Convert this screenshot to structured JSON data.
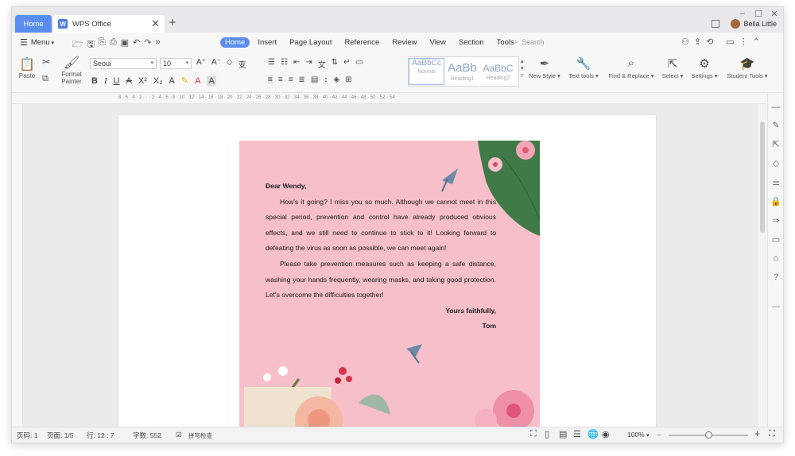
{
  "title_bar": {
    "home_tab": "Home",
    "doc_tab": "WPS Office",
    "doc_icon_letter": "W",
    "close_symbol": "✕",
    "add_symbol": "+",
    "user_name": "Bella Little",
    "window_controls": [
      "–",
      "☐",
      "✕"
    ]
  },
  "menu_bar": {
    "menu_label": "Menu",
    "tabs": [
      "Home",
      "Insert",
      "Page Layout",
      "Reference",
      "Review",
      "View",
      "Section",
      "Tools"
    ],
    "active_tab": "Home",
    "search_placeholder": "Search"
  },
  "ribbon": {
    "paste": "Paste",
    "format_painter_line1": "Format",
    "format_painter_line2": "Painter",
    "font_name": "Seoui",
    "font_size": "10",
    "styles": [
      {
        "sample": "AaBbCc",
        "name": "Normal"
      },
      {
        "sample": "AaBb",
        "name": "Heading1"
      },
      {
        "sample": "AaBbC",
        "name": "Heading2"
      }
    ],
    "new_style": "New Style",
    "text_tools": "Text tools",
    "find_replace": "Find & Replace",
    "select": "Select",
    "settings": "Settings",
    "student_tools": "Student Tools"
  },
  "ruler": {
    "ticks": "8 · 6 · 4 · 2 ·  ·  · 2 · 4 · 6 · 8 · 10 · 12 · 14 · 16 · 18 · 20 · 22 · 24 · 26 · 28 · 30 · 32 · 34 · 36 · 38 · 40 · 42 · 44 · 46 · 48 · 50 · 52 · 54"
  },
  "letter": {
    "salutation": "Dear Wendy,",
    "paragraph1": "How's it going? I miss you so much. Although we cannot meet in this special period, prevention and control have already produced obvious effects, and we still need to continue to stick to it! Looking forward to defeating the virus as soon as possible, we can meet again!",
    "paragraph2": "Please take prevention measures such as keeping a safe distance, washing your hands frequently, wearing masks, and taking good protection. Let's overcome the difficulties together!",
    "closing": "Yours faithfully,",
    "signature": "Tom"
  },
  "status_bar": {
    "page_no": "页码: 1",
    "page_count": "页面: 1/5",
    "line_col": "行: 12 : 7",
    "word_count": "字数: 552",
    "spellcheck": "拼写检查",
    "zoom": "100%",
    "zoom_level": 0.5
  },
  "colors": {
    "accent": "#5b8def",
    "letter_bg": "#f6bfc9"
  }
}
